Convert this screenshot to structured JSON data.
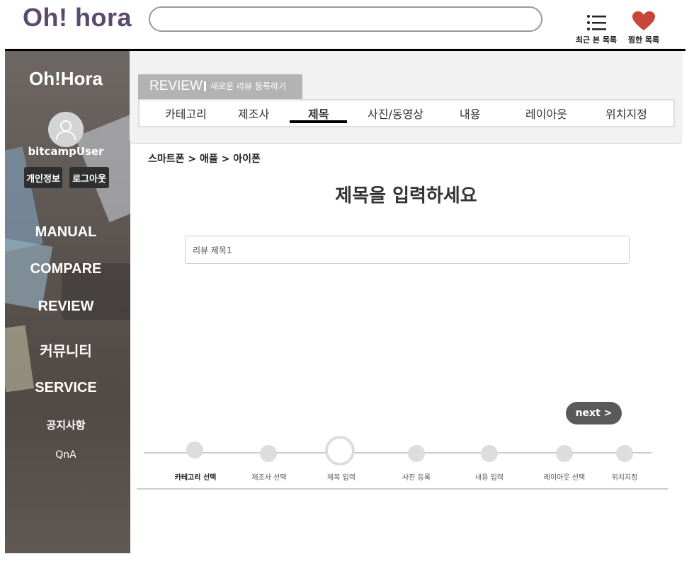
{
  "header": {
    "logo": "Oh! hora",
    "search_value": "",
    "recent_label": "최근 본 목록",
    "wish_label": "찜한 목록",
    "recent_icon": "list-icon",
    "wish_icon": "heart-icon",
    "heart_color": "#c9453a"
  },
  "sidebar": {
    "title": "Oh!Hora",
    "username": "bitcampUser",
    "profile_button": "개인정보",
    "logout_button": "로그아웃",
    "nav": [
      "MANUAL",
      "COMPARE",
      "REVIEW",
      "커뮤니티",
      "SERVICE"
    ],
    "sub": [
      "공지사항",
      "QnA"
    ]
  },
  "review_panel": {
    "tab_main": "REVIEW",
    "tab_sub": "새로운 리뷰 등록하기",
    "steps": [
      "카테고리",
      "제조사",
      "제목",
      "사진/동영상",
      "내용",
      "레이아웃",
      "위치지정"
    ],
    "active_step": "제목"
  },
  "main": {
    "breadcrumb": "스마트폰 > 애플 > 아이폰",
    "title": "제목을 입력하세요",
    "input_value": "리뷰 제목1",
    "next_button": "next >"
  },
  "progress": {
    "labels": [
      "카테고리 선택",
      "제조사 선택",
      "제목 입력",
      "사진 등록",
      "내용 입력",
      "레이아웃 선택",
      "위치지정"
    ],
    "current_index": 2
  }
}
